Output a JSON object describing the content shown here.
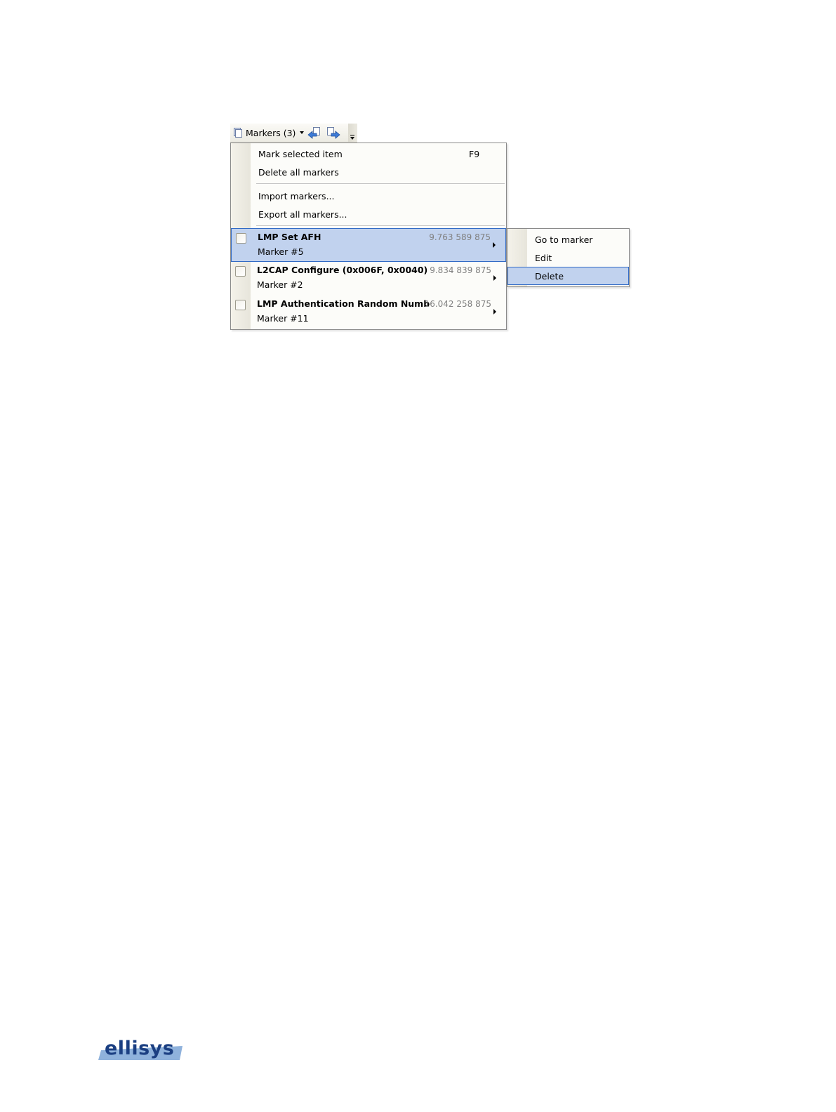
{
  "toolbar": {
    "markers_label": "Markers (3)"
  },
  "menu": {
    "mark_selected": {
      "label": "Mark selected item",
      "shortcut": "F9"
    },
    "delete_all": {
      "label": "Delete all markers"
    },
    "import": {
      "label": "Import markers..."
    },
    "export": {
      "label": "Export all markers..."
    },
    "markers": [
      {
        "title": "LMP Set AFH",
        "time": "9.763 589 875",
        "name": "Marker #5",
        "highlighted": true
      },
      {
        "title": "L2CAP Configure (0x006F, 0x0040)",
        "time": "9.834 839 875",
        "name": "Marker #2",
        "highlighted": false
      },
      {
        "title": "LMP Authentication Random Numb",
        "time": "16.042 258 875",
        "name": "Marker #11",
        "highlighted": false
      }
    ]
  },
  "submenu": {
    "items": [
      {
        "label": "Go to marker"
      },
      {
        "label": "Edit"
      },
      {
        "label": "Delete"
      }
    ]
  },
  "footer": {
    "logo_text": "ellisys"
  },
  "colors": {
    "highlight_bg": "#c1d2ee",
    "highlight_border": "#316ac5",
    "logo_blue": "#1b3f82",
    "logo_swoosh": "#8fb2dc"
  }
}
